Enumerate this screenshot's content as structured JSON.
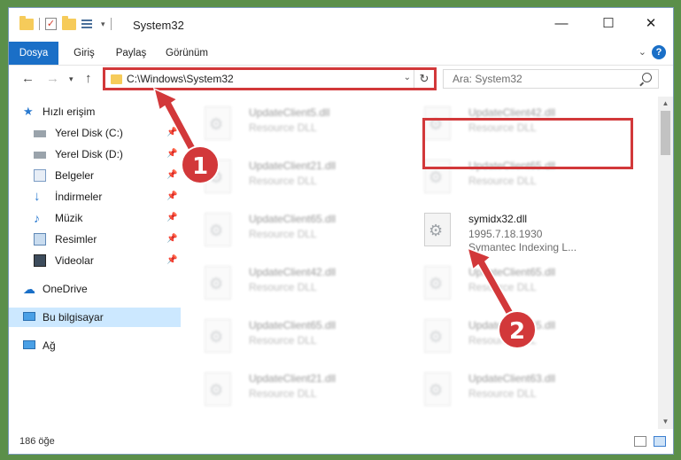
{
  "titlebar": {
    "title": "System32",
    "minimize_icon": "minimize-icon",
    "maximize_icon": "maximize-icon",
    "close_icon": "close-icon"
  },
  "ribbon": {
    "tabs": [
      "Dosya",
      "Giriş",
      "Paylaş",
      "Görünüm"
    ],
    "help_label": "?"
  },
  "address_bar": {
    "path": "C:\\Windows\\System32"
  },
  "search": {
    "placeholder": "Ara: System32"
  },
  "sidebar": {
    "items": [
      {
        "label": "Hızlı erişim",
        "icon": "star-icon"
      },
      {
        "label": "Yerel Disk (C:)",
        "icon": "drive-icon"
      },
      {
        "label": "Yerel Disk (D:)",
        "icon": "drive-icon"
      },
      {
        "label": "Belgeler",
        "icon": "documents-icon"
      },
      {
        "label": "İndirmeler",
        "icon": "download-icon"
      },
      {
        "label": "Müzik",
        "icon": "music-icon"
      },
      {
        "label": "Resimler",
        "icon": "pictures-icon"
      },
      {
        "label": "Videolar",
        "icon": "videos-icon"
      },
      {
        "label": "OneDrive",
        "icon": "cloud-icon"
      },
      {
        "label": "Bu bilgisayar",
        "icon": "computer-icon"
      },
      {
        "label": "Ağ",
        "icon": "network-icon"
      }
    ]
  },
  "files": {
    "left": [
      {
        "name": "UpdateClient5.dll",
        "desc": "Resource DLL"
      },
      {
        "name": "UpdateClient21.dll",
        "desc": "Resource DLL"
      },
      {
        "name": "UpdateClient65.dll",
        "desc": "Resource DLL"
      },
      {
        "name": "UpdateClient42.dll",
        "desc": "Resource DLL"
      },
      {
        "name": "UpdateClient65.dll",
        "desc": "Resource DLL"
      },
      {
        "name": "UpdateClient21.dll",
        "desc": "Resource DLL"
      }
    ],
    "right": [
      {
        "name": "UpdateClient42.dll",
        "desc": "Resource DLL"
      },
      {
        "name": "UpdateClient65.dll",
        "desc": "Resource DLL"
      },
      {
        "name": "UpdateClient65.dll",
        "desc": "Resource DLL"
      },
      {
        "name": "UpdateClient65.dll",
        "desc": "Resource DLL"
      },
      {
        "name": "UpdateClient63.dll",
        "desc": "Resource DLL"
      }
    ],
    "highlighted": {
      "name": "symidx32.dll",
      "version": "1995.7.18.1930",
      "desc": "Symantec Indexing L..."
    }
  },
  "status": {
    "count": "186 öğe"
  },
  "markers": {
    "one": "1",
    "two": "2"
  },
  "colors": {
    "accent": "#1a6fc7",
    "highlight": "#d2383a",
    "selected": "#cce8ff"
  }
}
